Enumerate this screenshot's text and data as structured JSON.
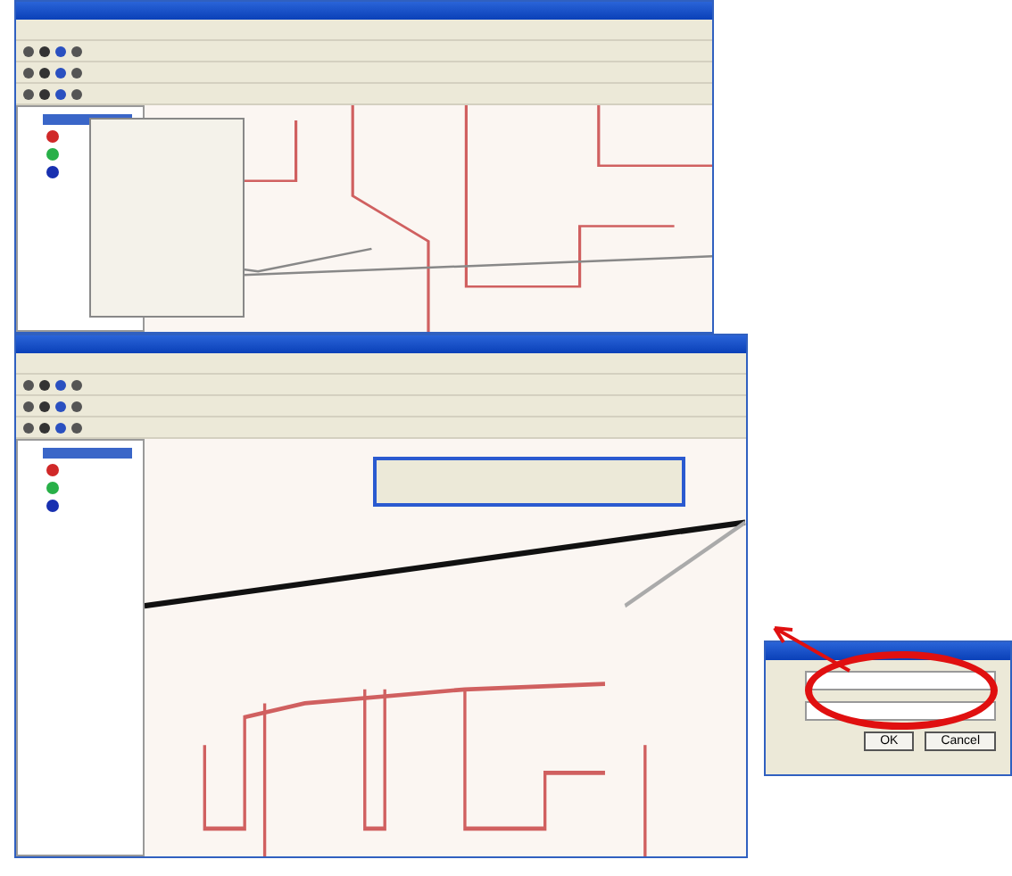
{
  "windows": [
    {
      "kind": "menu",
      "legend": [
        {
          "color": "#d02828"
        },
        {
          "color": "#28b048"
        },
        {
          "color": "#1830b0"
        }
      ]
    },
    {
      "kind": "float",
      "legend": [
        {
          "color": "#d02828"
        },
        {
          "color": "#28b048"
        },
        {
          "color": "#1830b0"
        }
      ]
    }
  ],
  "dialog": {
    "highlighted": true,
    "buttons": [
      {
        "label": "OK"
      },
      {
        "label": "Cancel"
      }
    ]
  }
}
